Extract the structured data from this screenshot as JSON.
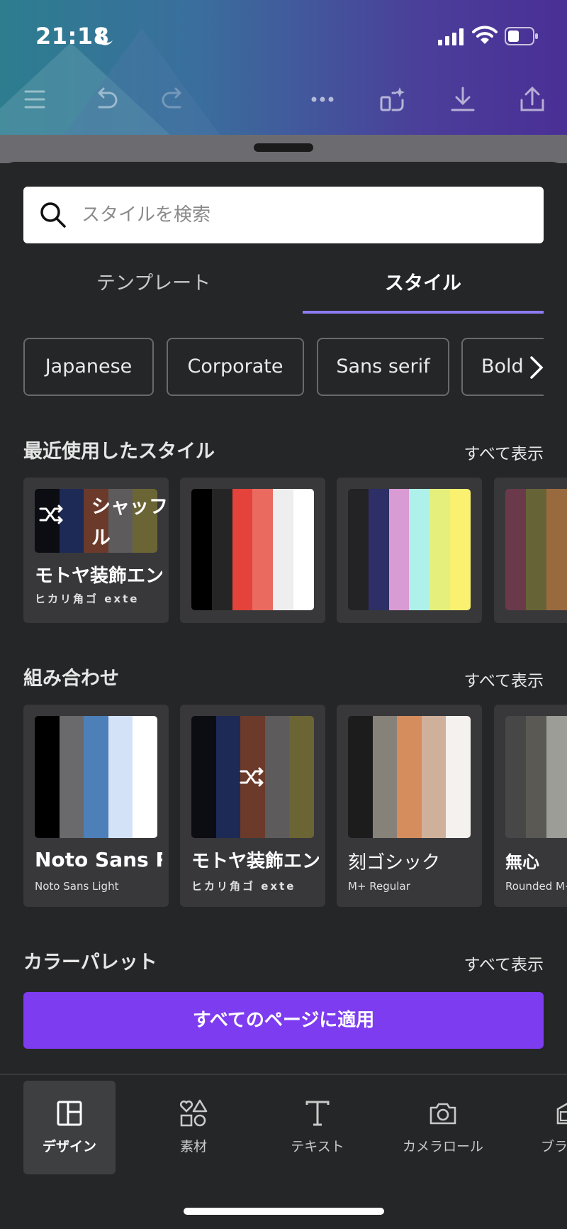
{
  "status_bar": {
    "time": "21:18"
  },
  "search": {
    "placeholder": "スタイルを検索"
  },
  "tabs": [
    {
      "label": "テンプレート",
      "active": false
    },
    {
      "label": "スタイル",
      "active": true
    }
  ],
  "chips": [
    "Japanese",
    "Corporate",
    "Sans serif",
    "Bold"
  ],
  "recent": {
    "title": "最近使用したスタイル",
    "see_all": "すべて表示",
    "cards": [
      {
        "colors": [
          "#0c0d12",
          "#1d2a55",
          "#6b3a2a",
          "#5d5b5c",
          "#6b6535"
        ],
        "shuffle_label": "シャッフル",
        "font_title": "モトヤ装飾エン",
        "font_sub": "ヒカリ角ゴ exte"
      },
      {
        "colors": [
          "#000000",
          "#252526",
          "#e3433a",
          "#ea6a5f",
          "#eeeeee",
          "#ffffff"
        ]
      },
      {
        "colors": [
          "#232326",
          "#2d2f66",
          "#d99bd4",
          "#aef0ea",
          "#e4ef7c",
          "#fbf170"
        ]
      },
      {
        "colors": [
          "#6b3a4a",
          "#666337",
          "#9a6a3f"
        ]
      }
    ]
  },
  "combos": {
    "title": "組み合わせ",
    "see_all": "すべて表示",
    "cards": [
      {
        "colors": [
          "#000000",
          "#6a6a6c",
          "#4d7fb8",
          "#d3e2f7",
          "#ffffff"
        ],
        "font_title": "Noto Sans Re",
        "font_sub": "Noto Sans Light"
      },
      {
        "colors": [
          "#0c0d12",
          "#1d2a55",
          "#6b3a2a",
          "#5d5b5c",
          "#6b6535"
        ],
        "font_title": "モトヤ装飾エン",
        "font_sub": "ヒカリ角ゴ exte"
      },
      {
        "colors": [
          "#1c1c1d",
          "#868279",
          "#d58d5d",
          "#cfb09a",
          "#f4f1ee"
        ],
        "font_title": "刻ゴシック",
        "font_sub": "M+ Regular"
      },
      {
        "colors": [
          "#474747",
          "#5b5954",
          "#9b9d96"
        ],
        "font_title": "無心",
        "font_sub": "Rounded M+"
      }
    ]
  },
  "palette": {
    "title": "カラーパレット",
    "see_all": "すべて表示"
  },
  "apply_button": "すべてのページに適用",
  "bottom_nav": [
    {
      "label": "デザイン",
      "icon": "layout-icon",
      "active": true
    },
    {
      "label": "素材",
      "icon": "elements-icon",
      "active": false
    },
    {
      "label": "テキスト",
      "icon": "text-icon",
      "active": false
    },
    {
      "label": "カメラロール",
      "icon": "camera-icon",
      "active": false
    },
    {
      "label": "ブラ",
      "icon": "brand-icon",
      "active": false
    }
  ]
}
